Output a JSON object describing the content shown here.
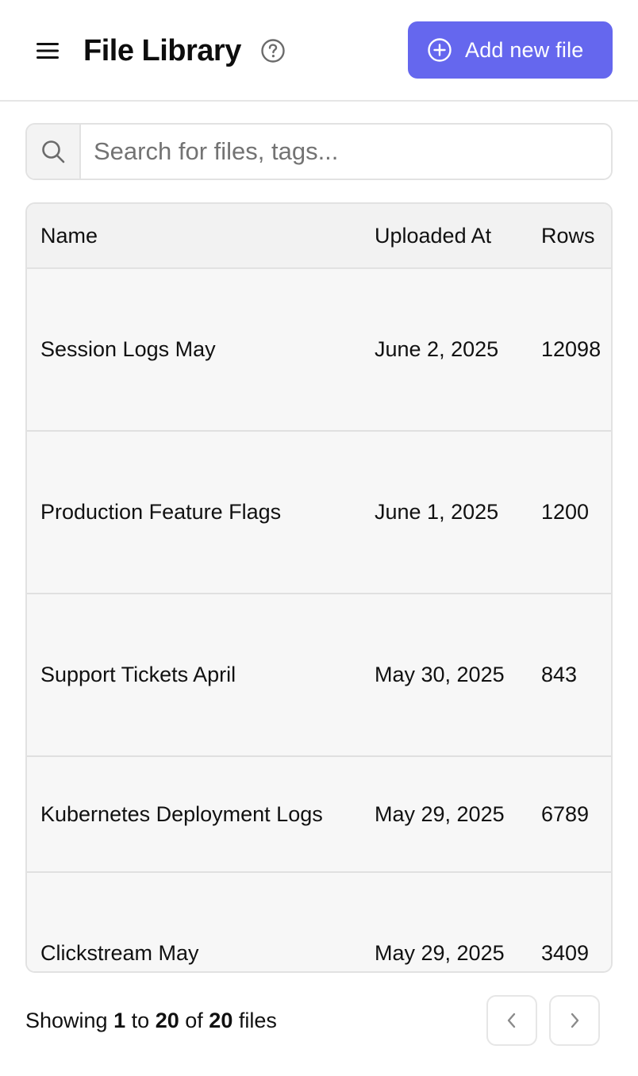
{
  "header": {
    "title": "File Library",
    "add_button_label": "Add new file",
    "menu_icon": "hamburger-menu-icon",
    "help_icon": "question-circle-icon",
    "add_icon": "plus-circle-icon",
    "accent_color": "#6567ee"
  },
  "search": {
    "placeholder": "Search for files, tags...",
    "value": "",
    "icon": "search-icon"
  },
  "table": {
    "columns": [
      "Name",
      "Uploaded At",
      "Rows"
    ],
    "rows": [
      {
        "name": "Session Logs May",
        "uploaded_at": "June 2, 2025",
        "rows": "12098"
      },
      {
        "name": "Production Feature Flags",
        "uploaded_at": "June 1, 2025",
        "rows": "1200"
      },
      {
        "name": "Support Tickets April",
        "uploaded_at": "May 30, 2025",
        "rows": "843"
      },
      {
        "name": "Kubernetes Deployment Logs",
        "uploaded_at": "May 29, 2025",
        "rows": "6789"
      },
      {
        "name": "Clickstream May",
        "uploaded_at": "May 29, 2025",
        "rows": "3409"
      }
    ]
  },
  "footer": {
    "showing_prefix": "Showing",
    "from": "1",
    "to_word": "to",
    "to": "20",
    "of_word": "of",
    "total": "20",
    "suffix": "files",
    "prev_icon": "chevron-left-icon",
    "next_icon": "chevron-right-icon"
  }
}
